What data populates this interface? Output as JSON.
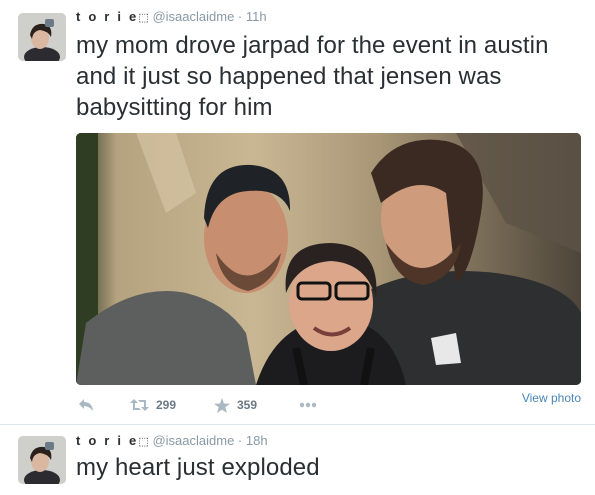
{
  "tweets": [
    {
      "name": "t o r i e",
      "name_glyph": "⬚",
      "handle": "@isaaclaidme",
      "separator": "·",
      "time": "11h",
      "text": "my mom drove jarpad for the event in austin and it just so happened that jensen was babysitting for him",
      "has_photo": true,
      "view_photo_label": "View photo",
      "retweets": "299",
      "favorites": "359"
    },
    {
      "name": "t o r i e",
      "name_glyph": "⬚",
      "handle": "@isaaclaidme",
      "separator": "·",
      "time": "18h",
      "text": "my heart just exploded"
    }
  ],
  "icons": {
    "reply": "reply-icon",
    "retweet": "retweet-icon",
    "favorite": "star-icon",
    "more": "more-dots-icon"
  },
  "colors": {
    "text": "#292f33",
    "meta": "#8899a6",
    "link": "#4a86b8",
    "divider": "#e1e8ed"
  }
}
